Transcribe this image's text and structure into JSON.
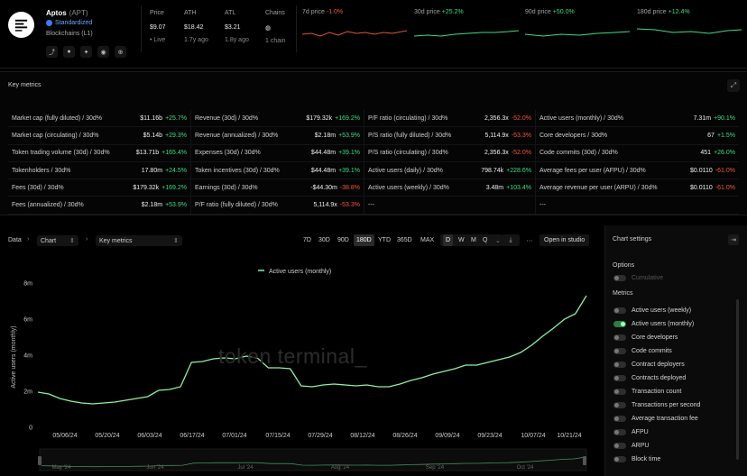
{
  "project": {
    "name": "Aptos",
    "ticker": "(APT)",
    "badge": "Standardized",
    "category": "Blockchains (L1)",
    "social_icons": [
      "link-icon",
      "github-icon",
      "twitter-icon",
      "discord-icon",
      "globe-icon"
    ]
  },
  "stats": {
    "price": {
      "label": "Price",
      "value": "$9.07",
      "sub": "Live"
    },
    "ath": {
      "label": "ATH",
      "value": "$18.42",
      "sub": "1.7y ago"
    },
    "atl": {
      "label": "ATL",
      "value": "$3.21",
      "sub": "1.8y ago"
    },
    "chains": {
      "label": "Chains",
      "value": "1 chain"
    }
  },
  "price_changes": [
    {
      "label": "7d price",
      "change": "-1.0%",
      "dir": "down"
    },
    {
      "label": "30d price",
      "change": "+25.2%",
      "dir": "up"
    },
    {
      "label": "90d price",
      "change": "+50.0%",
      "dir": "up"
    },
    {
      "label": "180d price",
      "change": "+12.4%",
      "dir": "up"
    }
  ],
  "metrics": {
    "title": "Key metrics",
    "rows": [
      [
        {
          "name": "Market cap (fully diluted) / 30d%",
          "value": "$11.16b",
          "change": "+25.7%",
          "dir": "up"
        },
        {
          "name": "Revenue (30d) / 30d%",
          "value": "$179.32k",
          "change": "+169.2%",
          "dir": "up"
        },
        {
          "name": "P/F ratio (circulating) / 30d%",
          "value": "2,356.3x",
          "change": "-52.0%",
          "dir": "down"
        },
        {
          "name": "Active users (monthly) / 30d%",
          "value": "7.31m",
          "change": "+90.1%",
          "dir": "up"
        }
      ],
      [
        {
          "name": "Market cap (circulating) / 30d%",
          "value": "$5.14b",
          "change": "+29.3%",
          "dir": "up"
        },
        {
          "name": "Revenue (annualized) / 30d%",
          "value": "$2.18m",
          "change": "+53.9%",
          "dir": "up"
        },
        {
          "name": "P/S ratio (fully diluted) / 30d%",
          "value": "5,114.9x",
          "change": "-53.3%",
          "dir": "down"
        },
        {
          "name": "Core developers / 30d%",
          "value": "67",
          "change": "+1.5%",
          "dir": "up"
        }
      ],
      [
        {
          "name": "Token trading volume (30d) / 30d%",
          "value": "$13.71b",
          "change": "+165.4%",
          "dir": "up"
        },
        {
          "name": "Expenses (30d) / 30d%",
          "value": "$44.48m",
          "change": "+39.1%",
          "dir": "up"
        },
        {
          "name": "P/S ratio (circulating) / 30d%",
          "value": "2,356.3x",
          "change": "-52.0%",
          "dir": "down"
        },
        {
          "name": "Code commits (30d) / 30d%",
          "value": "451",
          "change": "+26.0%",
          "dir": "up"
        }
      ],
      [
        {
          "name": "Tokenholders / 30d%",
          "value": "17.80m",
          "change": "+24.5%",
          "dir": "up"
        },
        {
          "name": "Token incentives (30d) / 30d%",
          "value": "$44.48m",
          "change": "+39.1%",
          "dir": "up"
        },
        {
          "name": "Active users (daily) / 30d%",
          "value": "798.74k",
          "change": "+228.6%",
          "dir": "up"
        },
        {
          "name": "Average fees per user (AFPU) / 30d%",
          "value": "$0.0110",
          "change": "-61.0%",
          "dir": "down"
        }
      ],
      [
        {
          "name": "Fees (30d) / 30d%",
          "value": "$179.32k",
          "change": "+169.2%",
          "dir": "up"
        },
        {
          "name": "Earnings (30d) / 30d%",
          "value": "-$44.30m",
          "change": "-38.8%",
          "dir": "down"
        },
        {
          "name": "Active users (weekly) / 30d%",
          "value": "3.48m",
          "change": "+103.4%",
          "dir": "up"
        },
        {
          "name": "Average revenue per user (ARPU) / 30d%",
          "value": "$0.0110",
          "change": "-61.0%",
          "dir": "down"
        }
      ],
      [
        {
          "name": "Fees (annualized) / 30d%",
          "value": "$2.18m",
          "change": "+53.9%",
          "dir": "up"
        },
        {
          "name": "P/F ratio (fully diluted) / 30d%",
          "value": "5,114.9x",
          "change": "-53.3%",
          "dir": "down"
        },
        {
          "name": "---",
          "value": "",
          "change": "",
          "dir": ""
        },
        {
          "name": "---",
          "value": "",
          "change": "",
          "dir": ""
        }
      ]
    ]
  },
  "toolbar": {
    "breadcrumb_root": "Data",
    "chart_select": "Chart",
    "metric_select": "Key metrics",
    "ranges": [
      "7D",
      "30D",
      "90D",
      "180D",
      "YTD",
      "365D",
      "MAX"
    ],
    "active_range": "180D",
    "granularity": [
      "D",
      "W",
      "M",
      "Q"
    ],
    "active_granularity": "D",
    "open_studio": "Open in studio"
  },
  "chart_data": {
    "type": "line",
    "ylabel": "Active users (monthly)",
    "series": [
      {
        "name": "Active users (monthly)",
        "color": "#8ef0a0"
      }
    ],
    "watermark": "token terminal_",
    "ylim": [
      0,
      8000000
    ],
    "yticks": [
      "0",
      "2m",
      "4m",
      "6m",
      "8m"
    ],
    "xticks": [
      "05/06/24",
      "05/20/24",
      "06/03/24",
      "06/17/24",
      "07/01/24",
      "07/15/24",
      "07/29/24",
      "08/12/24",
      "08/26/24",
      "09/09/24",
      "09/23/24",
      "10/07/24",
      "10/21/24"
    ],
    "x": [
      "04/28/24",
      "05/02/24",
      "05/06/24",
      "05/10/24",
      "05/14/24",
      "05/18/24",
      "05/22/24",
      "05/26/24",
      "05/30/24",
      "06/01/24",
      "06/03/24",
      "06/05/24",
      "06/07/24",
      "06/09/24",
      "06/11/24",
      "06/15/24",
      "06/19/24",
      "06/23/24",
      "06/27/24",
      "06/29/24",
      "07/02/24",
      "07/06/24",
      "07/10/24",
      "07/14/24",
      "07/18/24",
      "07/22/24",
      "07/26/24",
      "07/30/24",
      "08/03/24",
      "08/07/24",
      "08/11/24",
      "08/15/24",
      "08/19/24",
      "08/23/24",
      "08/27/24",
      "08/31/24",
      "09/04/24",
      "09/08/24",
      "09/12/24",
      "09/16/24",
      "09/20/24",
      "09/24/24",
      "09/28/24",
      "10/02/24",
      "10/06/24",
      "10/10/24",
      "10/14/24",
      "10/18/24",
      "10/22/24",
      "10/26/24",
      "10/28/24"
    ],
    "values": [
      1950000,
      1850000,
      1600000,
      1450000,
      1350000,
      1300000,
      1350000,
      1400000,
      1500000,
      1600000,
      1700000,
      2050000,
      2100000,
      2250000,
      3600000,
      3650000,
      3800000,
      3850000,
      3800000,
      3950000,
      3850000,
      3300000,
      3300000,
      3250000,
      2300000,
      2250000,
      2350000,
      2400000,
      2350000,
      2300000,
      2350000,
      2250000,
      2250000,
      2400000,
      2600000,
      2750000,
      2950000,
      3100000,
      3250000,
      3450000,
      3450000,
      3600000,
      3750000,
      3900000,
      4150000,
      4550000,
      5050000,
      5500000,
      6000000,
      6300000,
      7300000
    ]
  },
  "navigator": {
    "labels": [
      "May '24",
      "Jun '24",
      "Jul '24",
      "Aug '24",
      "Sep '24",
      "Oct '24"
    ]
  },
  "settings": {
    "title": "Chart settings",
    "options_label": "Options",
    "options": [
      {
        "label": "Cumulative",
        "on": false
      }
    ],
    "metrics_label": "Metrics",
    "metrics": [
      {
        "label": "Active users (weekly)",
        "on": false
      },
      {
        "label": "Active users (monthly)",
        "on": true
      },
      {
        "label": "Core developers",
        "on": false
      },
      {
        "label": "Code commits",
        "on": false
      },
      {
        "label": "Contract deployers",
        "on": false
      },
      {
        "label": "Contracts deployed",
        "on": false
      },
      {
        "label": "Transaction count",
        "on": false
      },
      {
        "label": "Transactions per second",
        "on": false
      },
      {
        "label": "Average transaction fee",
        "on": false
      },
      {
        "label": "AFPU",
        "on": false
      },
      {
        "label": "ARPU",
        "on": false
      },
      {
        "label": "Block time",
        "on": false
      }
    ]
  }
}
